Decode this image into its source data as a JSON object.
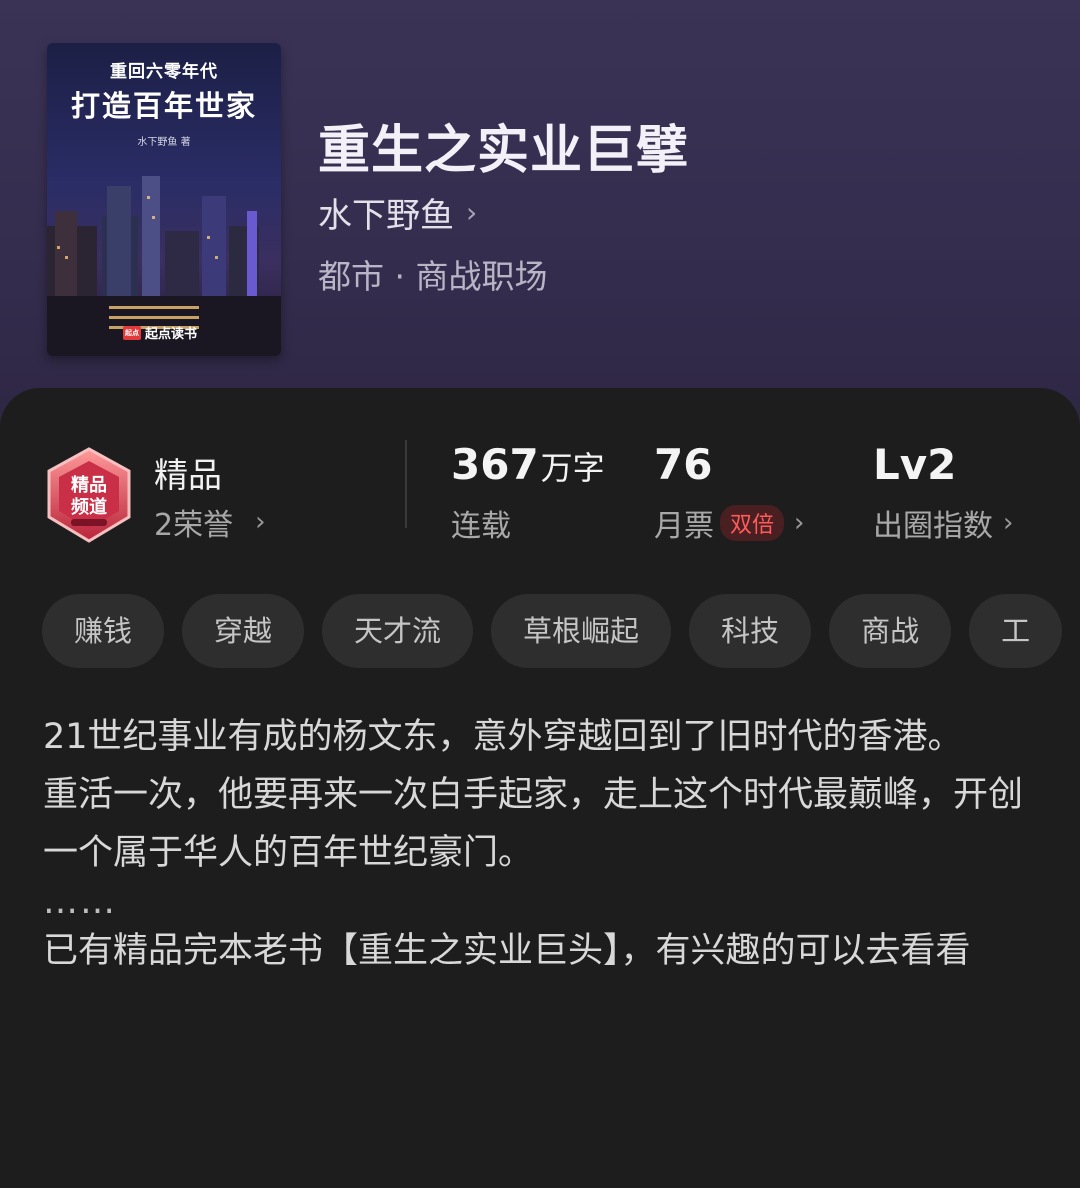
{
  "cover": {
    "series": "重回六零年代",
    "title": "打造百年世家",
    "author_line": "水下野鱼 著",
    "brand": "起点读书",
    "brand_logo": "起点"
  },
  "book": {
    "title": "重生之实业巨擘",
    "author": "水下野鱼",
    "genre": "都市 · 商战职场"
  },
  "stats": {
    "quality_title": "精品",
    "quality_sub": "2荣誉",
    "word_count": "367",
    "word_unit": "万字",
    "word_label": "连载",
    "monthly_tickets": "76",
    "monthly_label": "月票",
    "monthly_badge": "双倍",
    "level": "Lv2",
    "level_label": "出圈指数",
    "badge_text_top": "精品",
    "badge_text_bottom": "频道"
  },
  "tags": [
    "赚钱",
    "穿越",
    "天才流",
    "草根崛起",
    "科技",
    "商战",
    "工"
  ],
  "description": {
    "para1": "21世纪事业有成的杨文东，意外穿越回到了旧时代的香港。",
    "para2": "重活一次，他要再来一次白手起家，走上这个时代最巅峰，开创一个属于华人的百年世纪豪门。",
    "ellipsis": "……",
    "para3": "已有精品完本老书【重生之实业巨头】，有兴趣的可以去看看"
  },
  "colors": {
    "header_bg": "#352d4e",
    "panel_bg": "#1d1d1d",
    "tag_bg": "#2e2e2e",
    "double_badge": "#ff5b5b"
  }
}
